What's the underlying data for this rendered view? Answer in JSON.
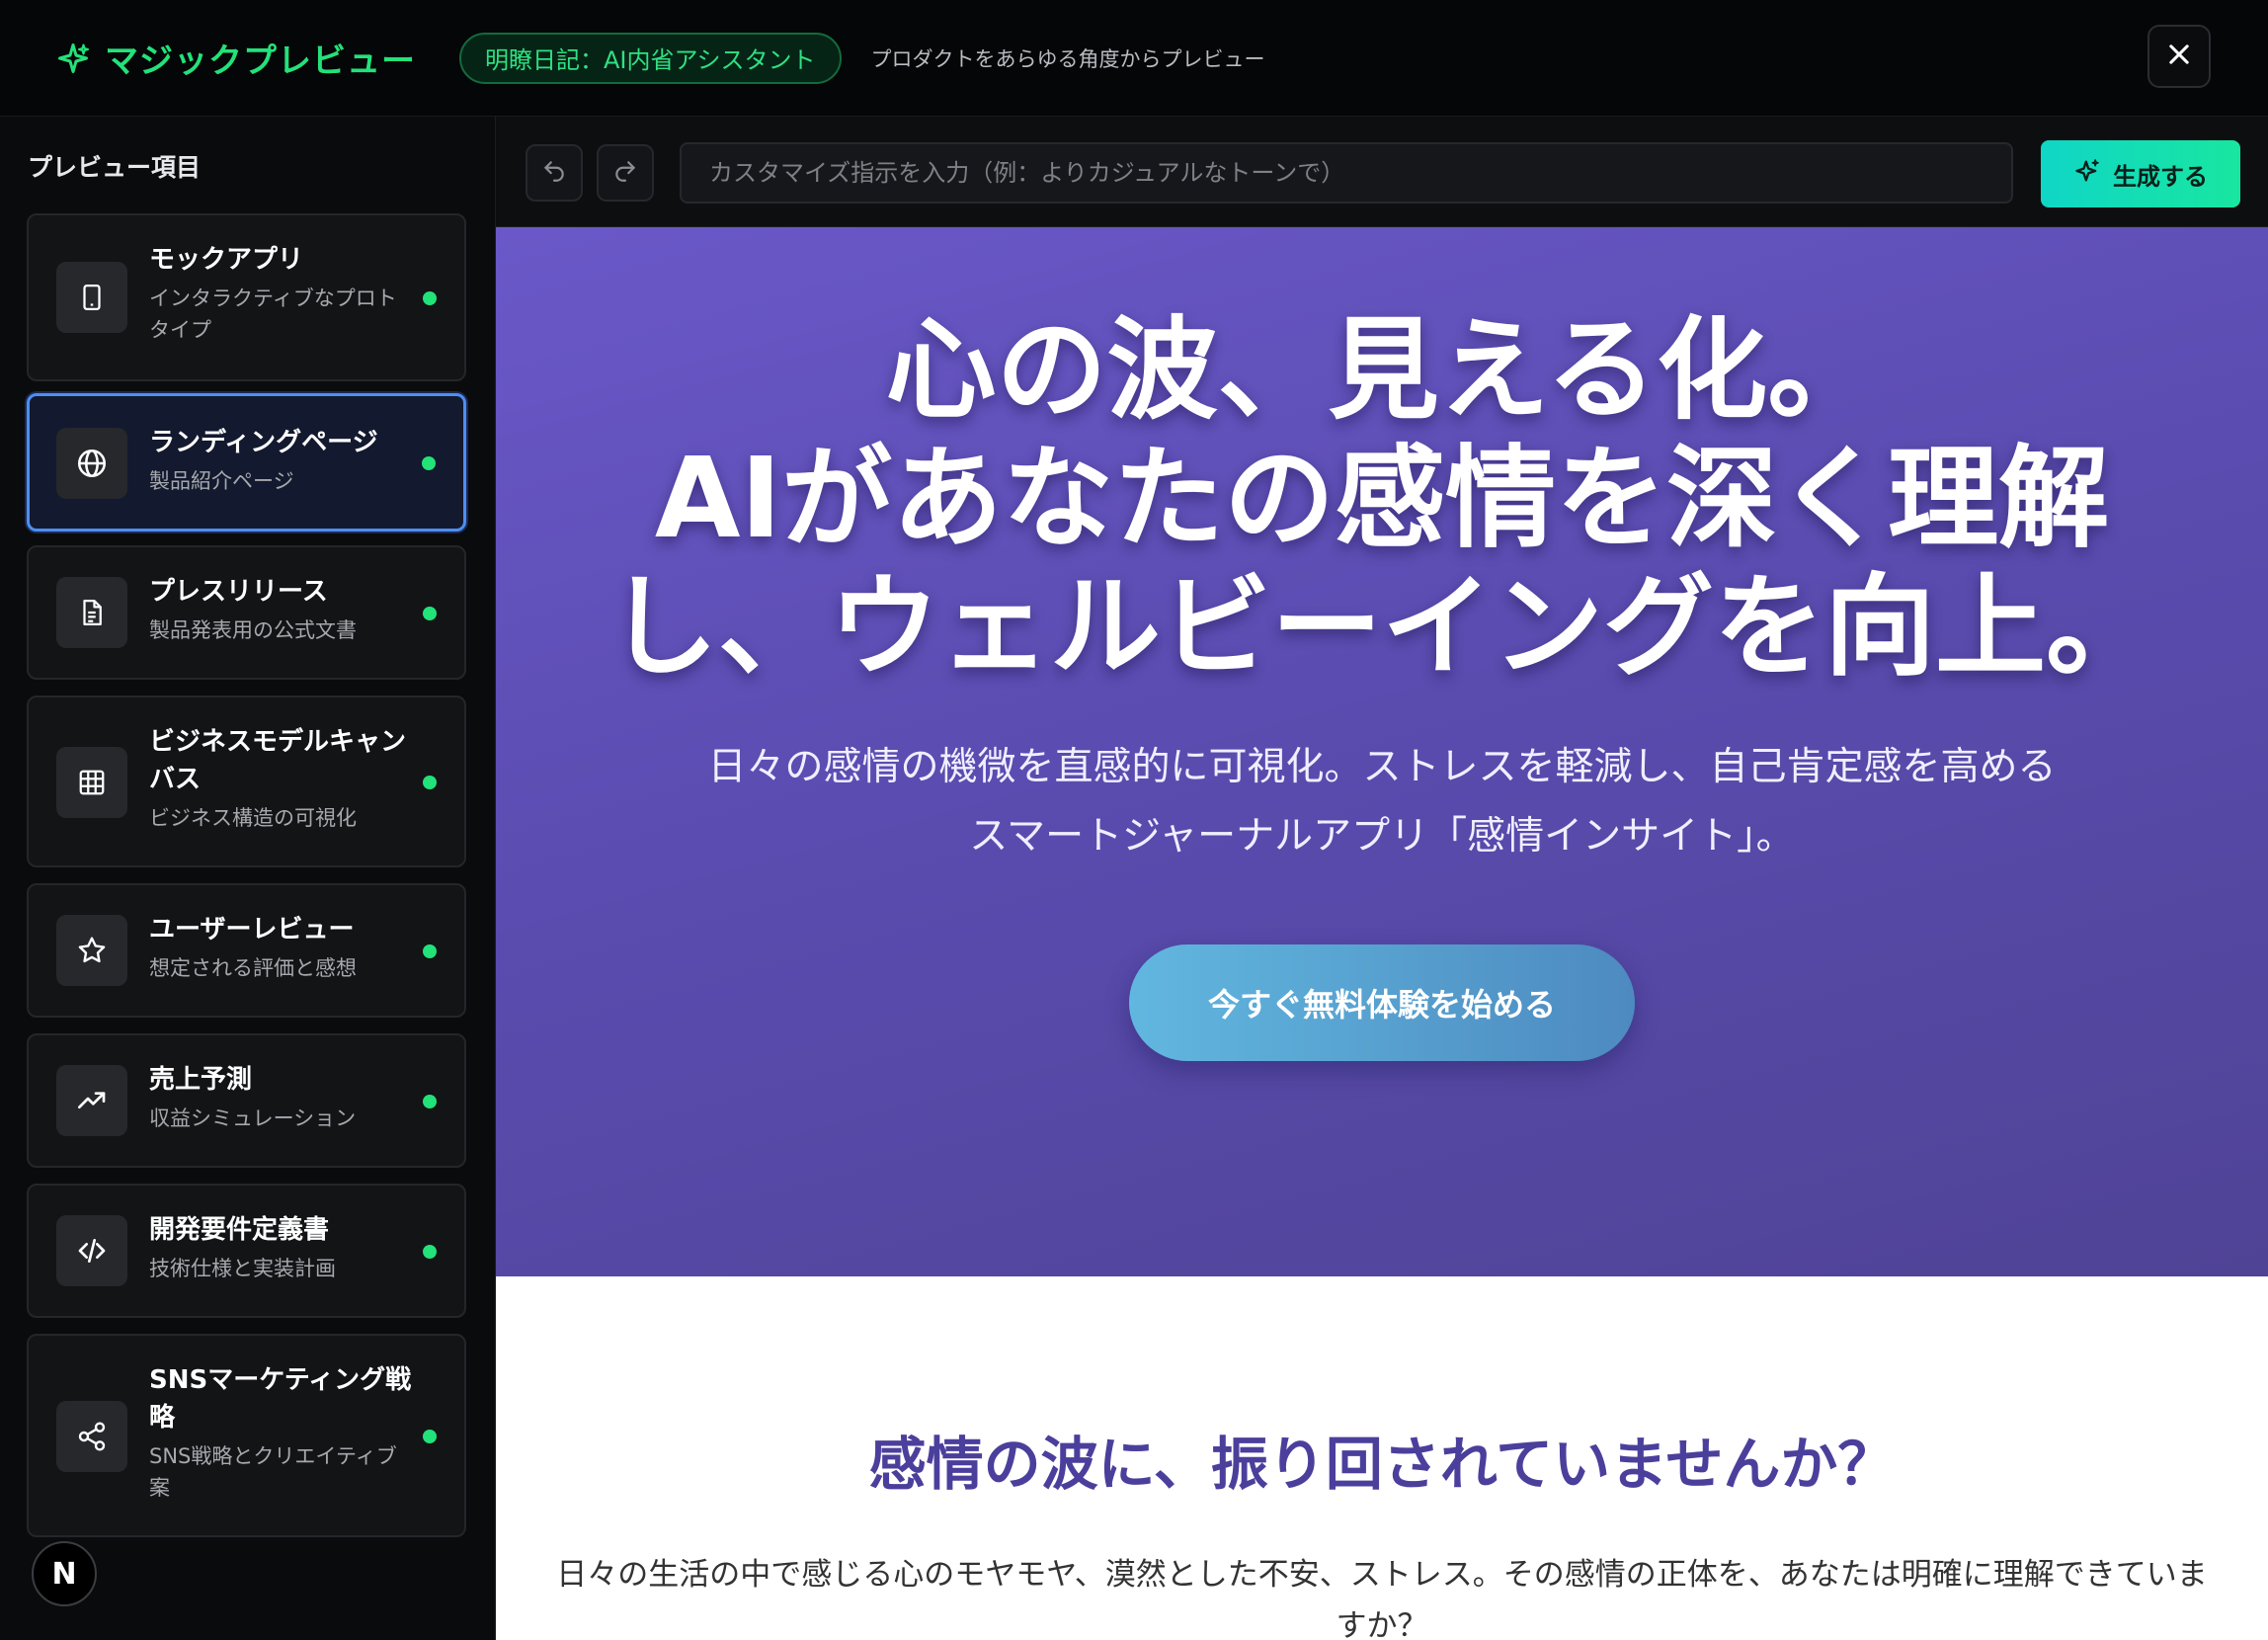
{
  "header": {
    "app_title": "マジックプレビュー",
    "project_badge": "明瞭日記：AI内省アシスタント",
    "subtitle": "プロダクトをあらゆる角度からプレビュー",
    "accent_color": "#22e27a",
    "close_icon": "close-icon"
  },
  "sidebar": {
    "title": "プレビュー項目",
    "items": [
      {
        "title": "モックアプリ",
        "desc": "インタラクティブなプロトタイプ",
        "icon": "phone-icon",
        "active": false
      },
      {
        "title": "ランディングページ",
        "desc": "製品紹介ページ",
        "icon": "globe-icon",
        "active": true
      },
      {
        "title": "プレスリリース",
        "desc": "製品発表用の公式文書",
        "icon": "document-icon",
        "active": false
      },
      {
        "title": "ビジネスモデルキャンバス",
        "desc": "ビジネス構造の可視化",
        "icon": "grid-icon",
        "active": false
      },
      {
        "title": "ユーザーレビュー",
        "desc": "想定される評価と感想",
        "icon": "star-icon",
        "active": false
      },
      {
        "title": "売上予測",
        "desc": "収益シミュレーション",
        "icon": "trending-up-icon",
        "active": false
      },
      {
        "title": "開発要件定義書",
        "desc": "技術仕様と実装計画",
        "icon": "code-icon",
        "active": false
      },
      {
        "title": "SNSマーケティング戦略",
        "desc": "SNS戦略とクリエイティブ案",
        "icon": "share-icon",
        "active": false
      }
    ],
    "avatar_letter": "N"
  },
  "toolbar": {
    "input_placeholder": "カスタマイズ指示を入力（例：よりカジュアルなトーンで）",
    "input_value": "",
    "generate_label": "生成する"
  },
  "preview": {
    "hero_title_lines": [
      "心の波、見える化。",
      "AIがあなたの感情を深く理解",
      "し、ウェルビーイングを向上。"
    ],
    "hero_sub_lines": [
      "日々の感情の機微を直感的に可視化。ストレスを軽減し、自己肯定感を高める",
      "スマートジャーナルアプリ「感情インサイト」。"
    ],
    "cta_label": "今すぐ無料体験を始める",
    "section_title": "感情の波に、振り回されていませんか？",
    "section_body_lines": [
      "日々の生活の中で感じる心のモヤモヤ、漠然とした不安、ストレス。その感情の正体を、あなたは明確に理解できていま",
      "すか？"
    ]
  }
}
